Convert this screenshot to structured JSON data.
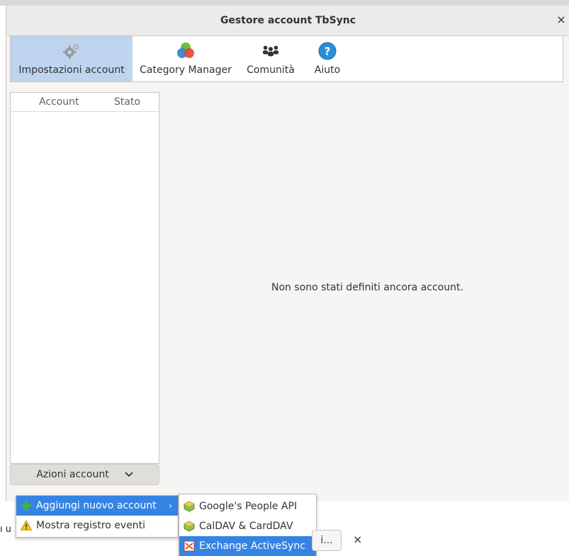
{
  "window": {
    "title": "Gestore account TbSync",
    "close_glyph": "×"
  },
  "toolbar": {
    "items": [
      {
        "label": "Impostazioni account",
        "icon": "gears-icon",
        "active": true
      },
      {
        "label": "Category Manager",
        "icon": "category-colors-icon",
        "active": false
      },
      {
        "label": "Comunità",
        "icon": "community-icon",
        "active": false
      },
      {
        "label": "Aiuto",
        "icon": "help-icon",
        "active": false
      }
    ]
  },
  "account_list": {
    "columns": [
      "Account",
      "Stato"
    ],
    "rows": []
  },
  "main": {
    "empty_message": "Non sono stati definiti ancora account."
  },
  "actions": {
    "label": "Azioni account",
    "chevron": "⌄"
  },
  "menu": {
    "items": [
      {
        "label": "Aggiungi nuovo account",
        "icon": "plus-icon",
        "highlighted": true,
        "has_submenu": true
      },
      {
        "label": "Mostra registro eventi",
        "icon": "warning-icon",
        "highlighted": false,
        "has_submenu": false
      }
    ],
    "submenu_arrow": "›"
  },
  "submenu": {
    "items": [
      {
        "label": "Google's People API",
        "icon": "provider-cube-icon",
        "highlighted": false
      },
      {
        "label": "CalDAV & CardDAV",
        "icon": "provider-cube-icon",
        "highlighted": false
      },
      {
        "label": "Exchange ActiveSync",
        "icon": "activesync-icon",
        "highlighted": true
      }
    ]
  },
  "background": {
    "left_text": "ı u",
    "notification_button": "i...",
    "notification_close": "×"
  },
  "colors": {
    "highlight": "#3584e4",
    "active_tab": "#bfd4ee",
    "window_bg": "#f6f5f4"
  }
}
